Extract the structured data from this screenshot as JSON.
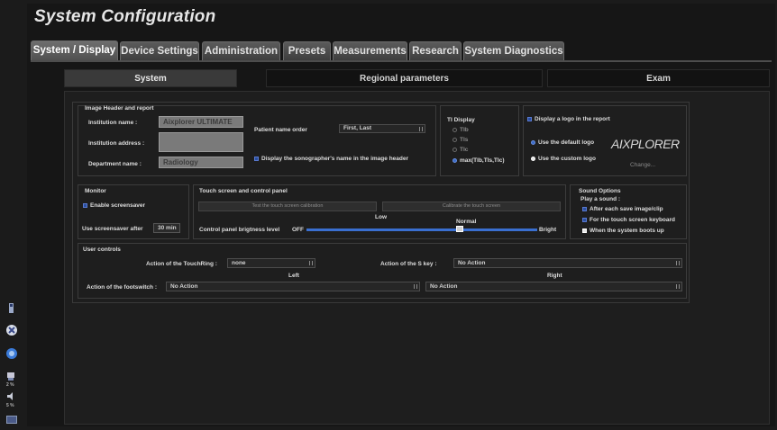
{
  "title": "System Configuration",
  "main_tabs": [
    "System / Display",
    "Device Settings",
    "Administration",
    "Presets",
    "Measurements",
    "Research",
    "System Diagnostics"
  ],
  "sub_tabs": [
    "System",
    "Regional parameters",
    "Exam"
  ],
  "image_header": {
    "heading": "Image Header and report",
    "institution_name_label": "Institution name :",
    "institution_name_value": "Aixplorer ULTIMATE",
    "institution_address_label": "Institution address :",
    "institution_address_value": "",
    "department_name_label": "Department name :",
    "department_name_value": "Radiology",
    "patient_name_order_label": "Patient name order",
    "patient_name_order_value": "First, Last",
    "display_sonographer_label": "Display the sonographer's name in the image header"
  },
  "ti_display": {
    "heading": "TI Display",
    "options": [
      "TIb",
      "TIs",
      "TIc",
      "max(TIb,TIs,TIc)"
    ],
    "selected_index": 3
  },
  "logo": {
    "display_logo_label": "Display a logo in the report",
    "default_logo_label": "Use the default logo",
    "custom_logo_label": "Use the custom logo",
    "logo_text": "AIXPLORER",
    "change_label": "Change..."
  },
  "monitor": {
    "heading": "Monitor",
    "enable_screensaver_label": "Enable screensaver",
    "use_screensaver_after_label": "Use screensaver after",
    "screensaver_value": "30 min"
  },
  "touch_screen": {
    "heading": "Touch screen and control panel",
    "test_calibration_button": "Test the touch screen calibration",
    "calibrate_button": "Calibrate the touch screen",
    "brightness_label": "Control panel brigtness level",
    "off_label": "OFF",
    "low_label": "Low",
    "normal_label": "Normal",
    "bright_label": "Bright"
  },
  "sound": {
    "heading": "Sound Options",
    "play_label": "Play a sound :",
    "options": [
      "After each save image/clip",
      "For the touch screen keyboard",
      "When the system boots up"
    ]
  },
  "user_controls": {
    "heading": "User controls",
    "touchring_label": "Action of the TouchRing :",
    "touchring_value": "none",
    "s_key_label": "Action of the S key :",
    "s_key_value": "No Action",
    "left_label": "Left",
    "right_label": "Right",
    "footswitch_label": "Action of the footswitch :",
    "footswitch_left_value": "No Action",
    "footswitch_right_value": "No Action"
  },
  "taskbar": {
    "icons": [
      "usb-icon",
      "power-icon",
      "network-icon",
      "printer-icon",
      "volume-icon",
      "screen-icon"
    ],
    "labels": [
      "2 %",
      "5 %"
    ]
  },
  "colors": {
    "accent_blue": "#2a4fa0",
    "background": "#161616",
    "field_gray": "#7a7a7a"
  }
}
